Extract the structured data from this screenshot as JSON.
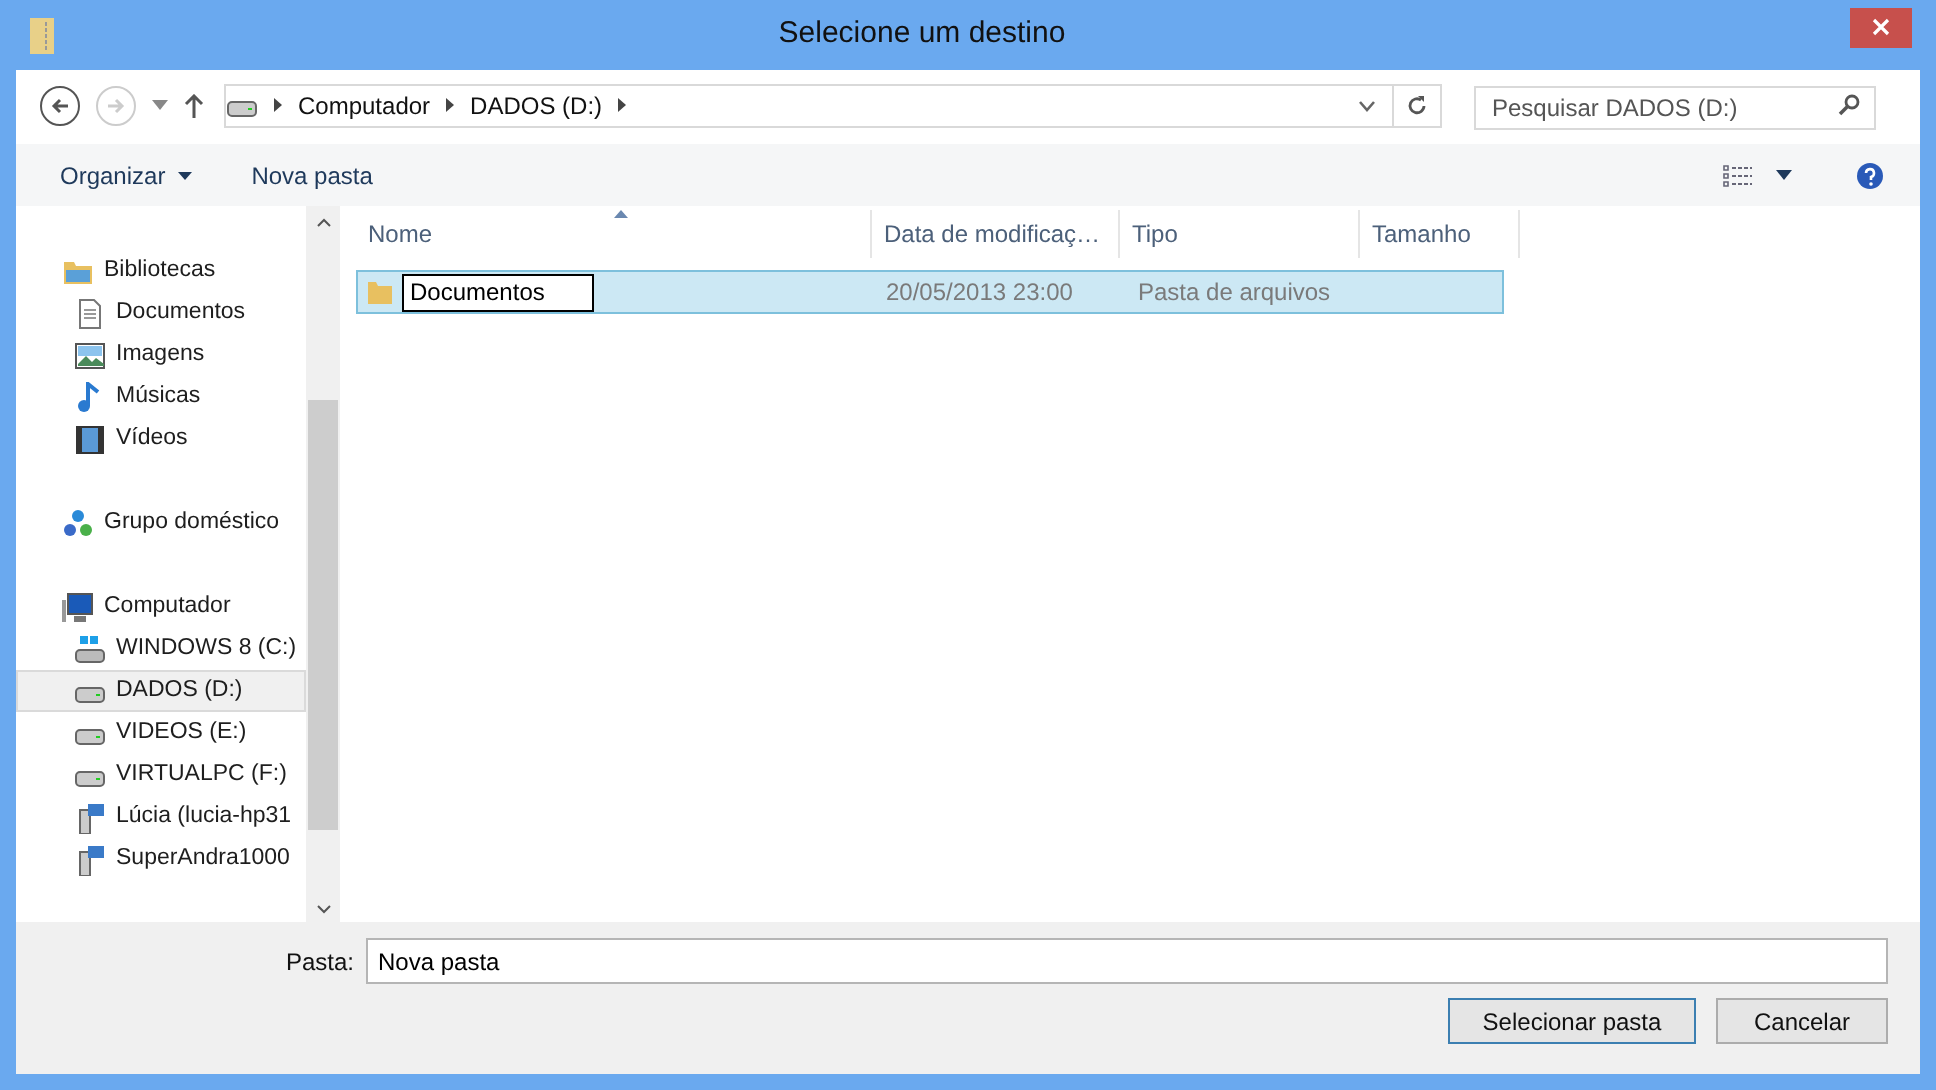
{
  "window": {
    "title": "Selecione um destino"
  },
  "nav": [
    {
      "kind": "back",
      "disabled": false
    },
    {
      "kind": "forward",
      "disabled": true
    }
  ],
  "address": {
    "crumbs": [
      "Computador",
      "DADOS (D:)"
    ]
  },
  "search": {
    "placeholder": "Pesquisar DADOS (D:)"
  },
  "toolbar": {
    "organize": "Organizar",
    "new_folder": "Nova pasta"
  },
  "sidebar": {
    "sections": [
      {
        "label": "Bibliotecas",
        "kind": "library",
        "children": [
          {
            "label": "Documentos",
            "kind": "doc",
            "selected": false
          },
          {
            "label": "Imagens",
            "kind": "image",
            "selected": false
          },
          {
            "label": "Músicas",
            "kind": "music",
            "selected": false
          },
          {
            "label": "Vídeos",
            "kind": "video",
            "selected": false
          }
        ]
      },
      {
        "label": "Grupo doméstico",
        "kind": "homegroup"
      },
      {
        "label": "Computador",
        "kind": "computer",
        "children": [
          {
            "label": "WINDOWS 8 (C:)",
            "kind": "windrive",
            "selected": false
          },
          {
            "label": "DADOS (D:)",
            "kind": "drive",
            "selected": true
          },
          {
            "label": "VIDEOS (E:)",
            "kind": "drive",
            "selected": false
          },
          {
            "label": "VIRTUALPC (F:)",
            "kind": "drive",
            "selected": false
          },
          {
            "label": "Lúcia (lucia-hp31",
            "kind": "netdrive",
            "selected": false
          },
          {
            "label": "SuperAndra1000",
            "kind": "netdrive",
            "selected": false
          }
        ]
      }
    ]
  },
  "table": {
    "columns": [
      {
        "label": "Nome",
        "sorted": true
      },
      {
        "label": "Data de modificaç…",
        "sorted": false
      },
      {
        "label": "Tipo",
        "sorted": false
      },
      {
        "label": "Tamanho",
        "sorted": false
      }
    ],
    "rows": [
      {
        "name": "Documentos",
        "date": "20/05/2013 23:00",
        "type": "Pasta de arquivos",
        "selected": true,
        "editing": true
      }
    ]
  },
  "folder_field": {
    "label": "Pasta:",
    "value": "Nova pasta"
  },
  "buttons": [
    {
      "label": "Selecionar pasta",
      "default": true
    },
    {
      "label": "Cancelar",
      "default": false
    }
  ]
}
